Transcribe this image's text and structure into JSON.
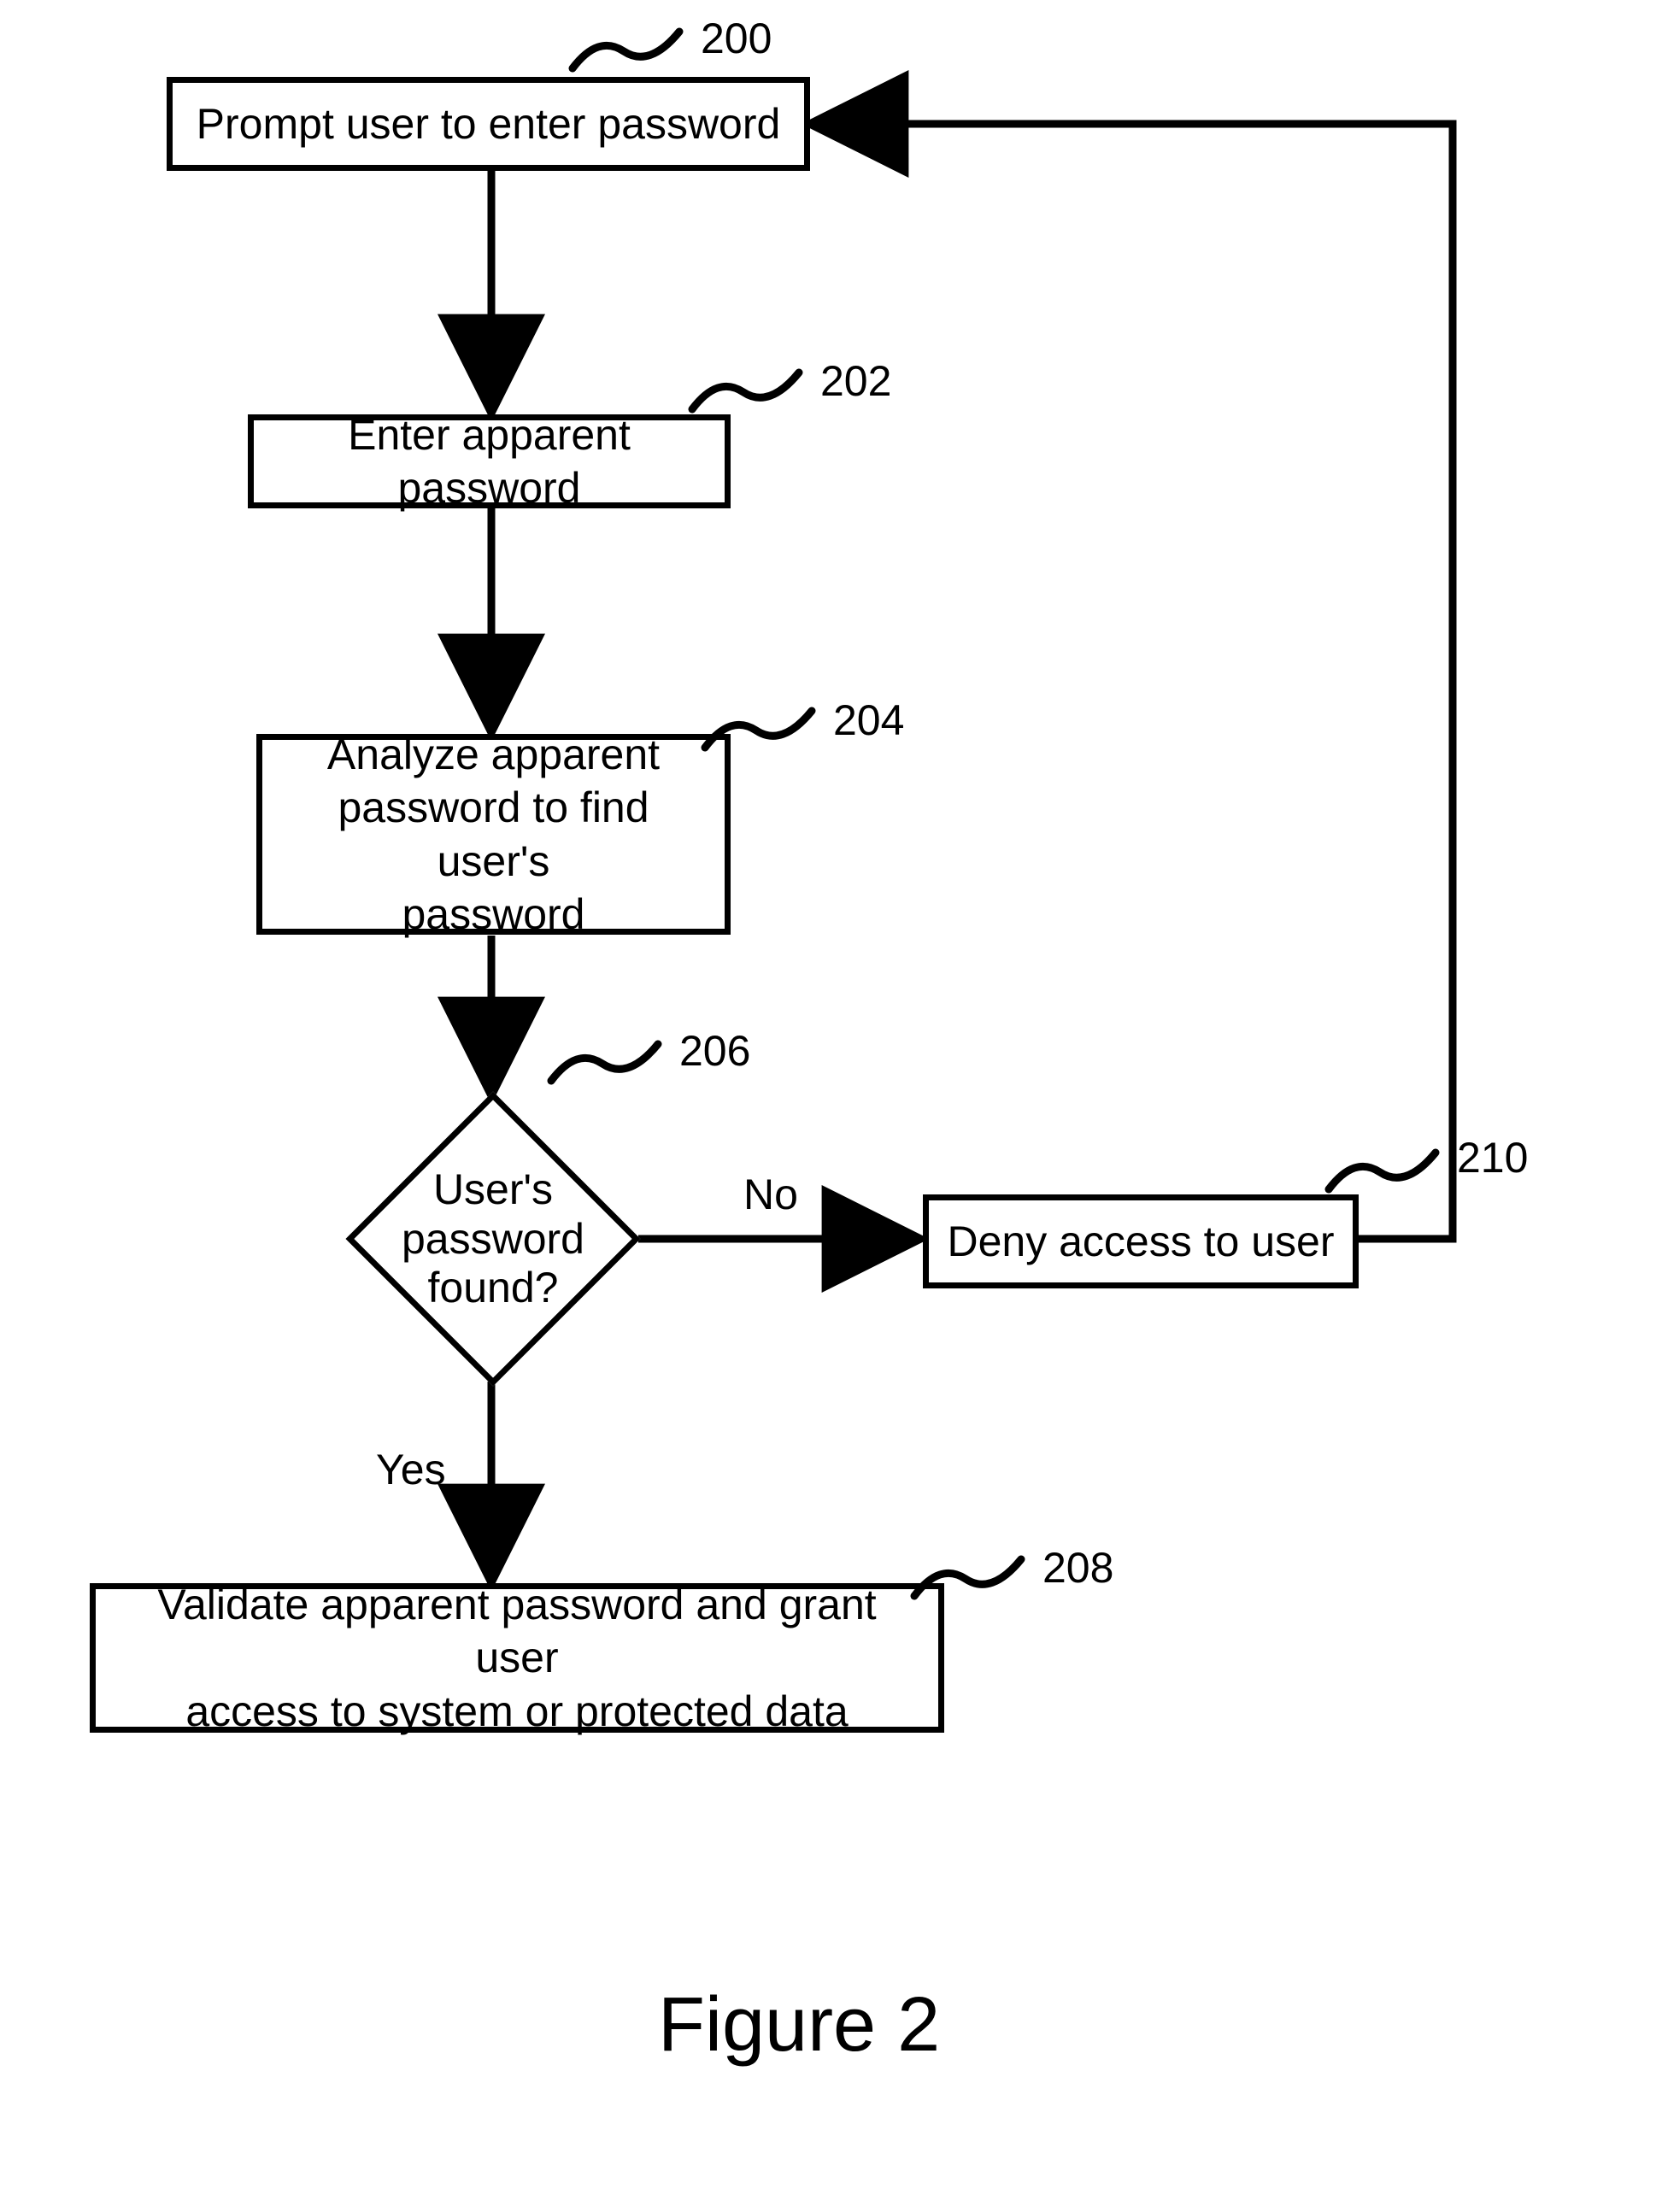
{
  "nodes": {
    "n200": {
      "text": "Prompt user to enter password",
      "ref": "200"
    },
    "n202": {
      "text": "Enter apparent password",
      "ref": "202"
    },
    "n204": {
      "text": "Analyze apparent\npassword to find user's\npassword",
      "ref": "204"
    },
    "n206": {
      "text": "User's\npassword\nfound?",
      "ref": "206"
    },
    "n208": {
      "text": "Validate apparent password and grant user\naccess to system or protected data",
      "ref": "208"
    },
    "n210": {
      "text": "Deny access to user",
      "ref": "210"
    }
  },
  "edges": {
    "yes": "Yes",
    "no": "No"
  },
  "caption": "Figure 2"
}
